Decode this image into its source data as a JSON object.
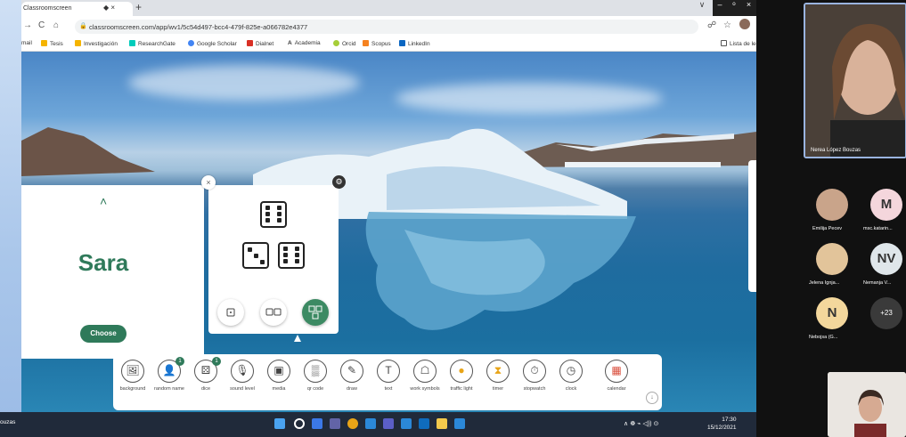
{
  "browser": {
    "tab_title": "Classroomscreen",
    "tab_controls": "◆ ×",
    "new_tab": "+",
    "window_controls": {
      "chevron": "∨",
      "minimize": "–",
      "restore": "ᵒ",
      "close": "×"
    },
    "url": "classroomscreen.com/app/wv1/5c54d497-bcc4-479f-825e-a066782e4377",
    "bookmarks": [
      "mail",
      "Tesis",
      "Investigación",
      "ResearchGate",
      "Google Scholar",
      "Dialnet",
      "Academia",
      "Orcid",
      "Scopus",
      "LinkedIn"
    ],
    "reading_list": "Lista de le"
  },
  "name_picker": {
    "name": "Sara",
    "choose_label": "Choose",
    "chevron": "˄"
  },
  "dice_widget": {
    "close_icon": "×",
    "settings_icon": "⚙"
  },
  "toolbar": {
    "tools": [
      {
        "label": "background",
        "icon": "🖼"
      },
      {
        "label": "random name",
        "icon": "👤",
        "badge": "1"
      },
      {
        "label": "dice",
        "icon": "⚄",
        "badge": "1"
      },
      {
        "label": "sound level",
        "icon": "🎙"
      },
      {
        "label": "media",
        "icon": "▣"
      },
      {
        "label": "qr code",
        "icon": "▒"
      },
      {
        "label": "draw",
        "icon": "✎"
      },
      {
        "label": "text",
        "icon": "T"
      },
      {
        "label": "work symbols",
        "icon": "☖"
      },
      {
        "label": "traffic light",
        "icon": "●"
      },
      {
        "label": "timer",
        "icon": "⧗"
      },
      {
        "label": "stopwatch",
        "icon": "⏱"
      },
      {
        "label": "clock",
        "icon": "◷"
      },
      {
        "label": "calendar",
        "icon": "▦"
      }
    ],
    "more_icon": "↓"
  },
  "taskbar": {
    "left_label": "ouzas",
    "time": "17:30",
    "date": "15/12/2021",
    "tray": "∧ ☸ ⌁ ◁)) ⊙"
  },
  "meeting": {
    "presenter_name": "Nerea López Bouzas",
    "participants": [
      {
        "initials": "",
        "name": "Emilija Pecev",
        "bg": "#c9a48a"
      },
      {
        "initials": "M",
        "name": "msc.katarin...",
        "bg": "#f4d6dc"
      },
      {
        "initials": "",
        "name": "Jelena Ignja...",
        "bg": "#e2c49a"
      },
      {
        "initials": "NV",
        "name": "Nemanja V...",
        "bg": "#dfe6ea"
      },
      {
        "initials": "N",
        "name": "Nebojsa (G...",
        "bg": "#f3d79c"
      },
      {
        "initials": "+23",
        "name": "",
        "bg": "#3a3a3a"
      }
    ]
  },
  "colors": {
    "brand_green": "#2f7a5a",
    "taskbar": "#202a3a"
  }
}
